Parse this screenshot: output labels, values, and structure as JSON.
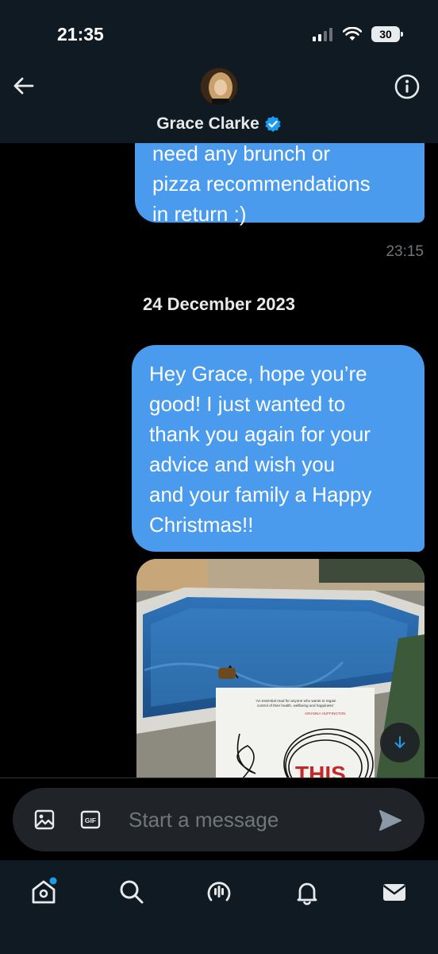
{
  "status_bar": {
    "time": "21:35",
    "battery": "30"
  },
  "header": {
    "contact_name": "Grace Clarke"
  },
  "messages": {
    "first": {
      "lines": [
        "need any brunch or",
        "pizza recommendations",
        "in return :)"
      ],
      "time": "23:15"
    },
    "date_separator": "24 December 2023",
    "second": {
      "lines": [
        "Hey Grace, hope you’re",
        "good! I just wanted to",
        "thank you again for your",
        "advice and wish you",
        "and your family a Happy",
        "Christmas!!"
      ]
    }
  },
  "photo": {
    "book_quote": [
      "'An essential read for anyone who wants to regain",
      "control of their health, wellbeing and happiness'"
    ],
    "book_author": "ARIANNA HUFFINGTON",
    "book_title": "THIS"
  },
  "composer": {
    "placeholder": "Start a message"
  },
  "colors": {
    "bubble": "#4a9bee",
    "verified": "#1d9bf0",
    "background": "#000000",
    "header": "#0f1a22"
  },
  "icons": [
    "back-arrow-icon",
    "info-icon",
    "verified-badge-icon",
    "arrow-down-icon",
    "image-icon",
    "gif-icon",
    "send-icon",
    "home-icon",
    "search-icon",
    "spaces-icon",
    "notifications-icon",
    "mail-icon"
  ]
}
